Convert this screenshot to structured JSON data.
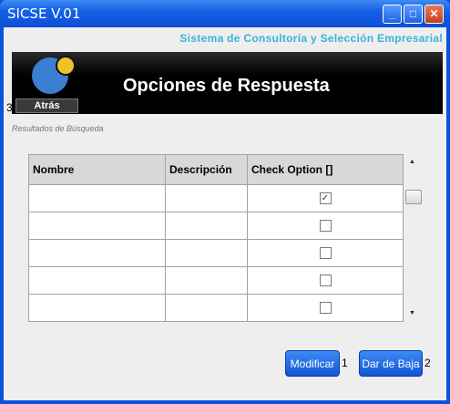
{
  "window": {
    "title": "SICSE V.01",
    "minimize": "_",
    "maximize": "□",
    "close": "✕"
  },
  "header": {
    "subtitle": "Sistema de Consultoría y Selección Empresarial"
  },
  "banner": {
    "title": "Opciones de Respuesta",
    "back_label": "Atrás",
    "left_number": "3"
  },
  "results_label": "Resultados de Búsqueda",
  "table": {
    "columns": [
      "Nombre",
      "Descripción",
      "Check Option []"
    ],
    "rows": [
      {
        "nombre": "",
        "descripcion": "",
        "checked": true
      },
      {
        "nombre": "",
        "descripcion": "",
        "checked": false
      },
      {
        "nombre": "",
        "descripcion": "",
        "checked": false
      },
      {
        "nombre": "",
        "descripcion": "",
        "checked": false
      },
      {
        "nombre": "",
        "descripcion": "",
        "checked": false
      }
    ]
  },
  "scrollbar": {
    "up_arrow": "▲",
    "down_arrow": "▼"
  },
  "actions": {
    "modify_label": "Modificar",
    "modify_number": "1",
    "delete_label": "Dar de Baja",
    "delete_number": "2"
  },
  "colors": {
    "accent": "#3bb3d6",
    "title_bar": "#0b4fd6",
    "button": "#1a5ee0"
  }
}
